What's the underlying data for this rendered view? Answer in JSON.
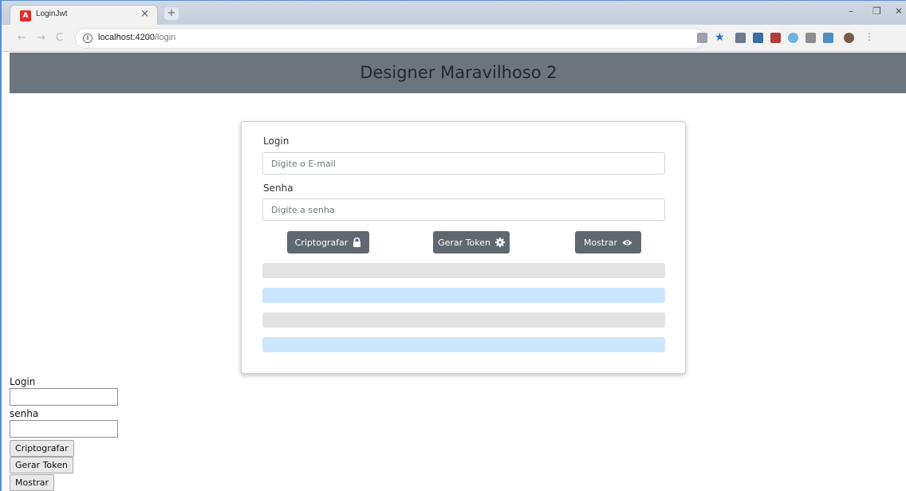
{
  "browser": {
    "tab_title": "LoginJwt",
    "tab_favicon": "A",
    "tab_close": "×",
    "new_tab": "+",
    "url_host": "localhost:4200",
    "url_path": "/login",
    "controls": {
      "minimize": "–",
      "maximize": "❐",
      "close": "✕"
    },
    "nav": {
      "back": "←",
      "forward": "→",
      "reload": "C"
    }
  },
  "header": {
    "title": "Designer Maravilhoso 2"
  },
  "form": {
    "login_label": "Login",
    "login_placeholder": "Digite o E-mail",
    "senha_label": "Senha",
    "senha_placeholder": "Digite a senha",
    "buttons": {
      "criptografar": "Criptografar",
      "gerar_token": "Gerar Token",
      "mostrar": "Mostrar"
    },
    "result_bars": [
      {
        "color": "#e2e3e5"
      },
      {
        "color": "#cce5ff"
      },
      {
        "color": "#e2e3e5"
      },
      {
        "color": "#cce5ff"
      }
    ]
  },
  "plain_form": {
    "login_label": "Login",
    "senha_label": "senha",
    "criptografar": "Criptografar",
    "gerar_token": "Gerar Token",
    "mostrar": "Mostrar"
  },
  "colors": {
    "header_bg": "#6c757d",
    "button_bg": "#5f6871",
    "alert_gray": "#e2e3e5",
    "alert_blue": "#cce5ff"
  },
  "icons": [
    "lock-icon",
    "gear-icon",
    "eye-icon",
    "info-icon",
    "star-icon",
    "angular-favicon"
  ]
}
